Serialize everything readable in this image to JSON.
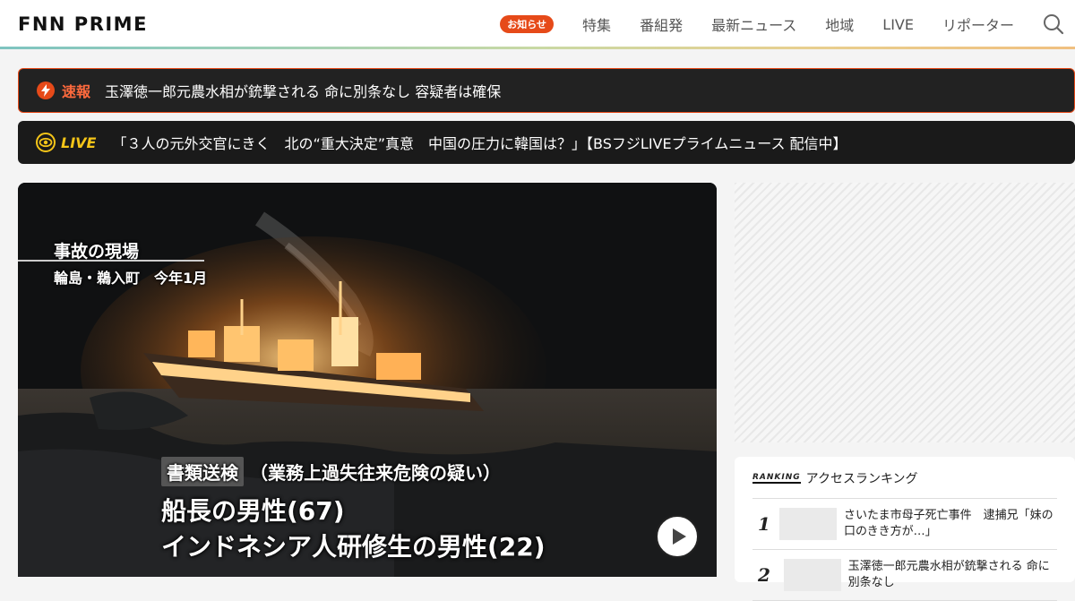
{
  "header": {
    "logo": "FNN PRIME",
    "notice_label": "お知らせ",
    "nav": [
      "特集",
      "番組発",
      "最新ニュース",
      "地域",
      "LIVE",
      "リポーター"
    ],
    "logo_colors": [
      "#e53935",
      "#1e88e5",
      "#43a047"
    ]
  },
  "breaking": {
    "label": "速報",
    "text": "玉澤徳一郎元農水相が銃撃される 命に別条なし 容疑者は確保",
    "accent": "#e64a19"
  },
  "live": {
    "label": "LIVE",
    "text": "「３人の元外交官にきく　北の“重大決定”真意　中国の圧力に韓国は？」【BSフジLIVEプライムニュース 配信中】",
    "accent": "#f5c518"
  },
  "hero": {
    "caption_title": "事故の現場",
    "caption_place": "輪島・鵜入町　今年1月",
    "tag": "書類送検",
    "subline": "（業務上過失往来危険の疑い）",
    "line1": "船長の男性(67)",
    "line2": "インドネシア人研修生の男性(22)",
    "play_icon": "play-icon"
  },
  "ranking": {
    "badge": "RANKING",
    "title": "アクセスランキング",
    "items": [
      {
        "rank": "1",
        "text": "さいたま市母子死亡事件　逮捕兄「妹の口のきき方が…」"
      },
      {
        "rank": "2",
        "text": "玉澤徳一郎元農水相が銃撃される 命に別条なし"
      }
    ]
  }
}
